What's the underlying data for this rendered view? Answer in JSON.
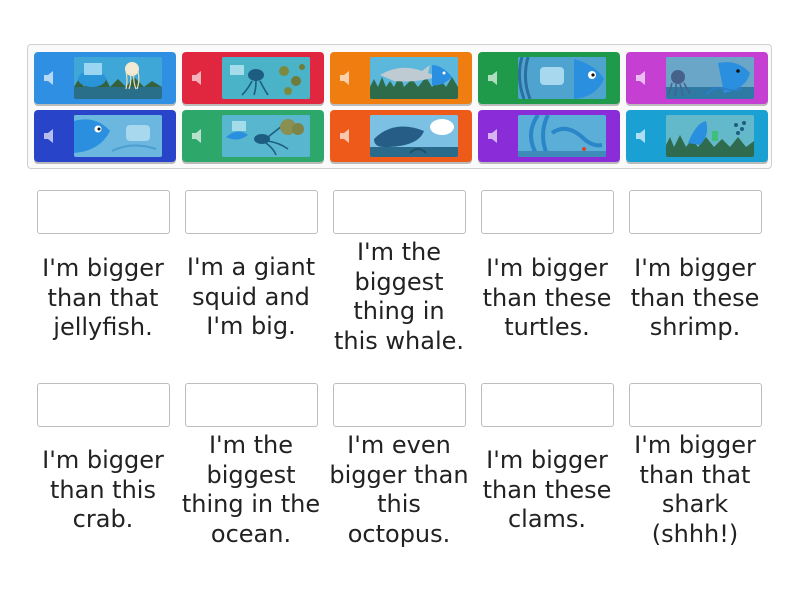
{
  "tiles": [
    {
      "color": "#2e8fe3",
      "picture": "jellyfish-picture"
    },
    {
      "color": "#e0273f",
      "picture": "turtles-picture"
    },
    {
      "color": "#f07d10",
      "picture": "shark-picture"
    },
    {
      "color": "#1f9a4a",
      "picture": "whale-picture"
    },
    {
      "color": "#c53fd2",
      "picture": "octopus-picture"
    },
    {
      "color": "#2845c9",
      "picture": "whale-tail-picture"
    },
    {
      "color": "#2ea86a",
      "picture": "squid-picture"
    },
    {
      "color": "#ee5a19",
      "picture": "whale-ocean-picture"
    },
    {
      "color": "#8a2dd9",
      "picture": "crab-picture"
    },
    {
      "color": "#1aa0d3",
      "picture": "shrimp-picture"
    }
  ],
  "labels": [
    "I'm bigger than that jellyfish.",
    "I'm a giant squid and I'm big.",
    "I'm the biggest thing in this whale.",
    "I'm bigger than these turtles.",
    "I'm bigger than these shrimp.",
    "I'm bigger than this crab.",
    "I'm the biggest thing in the ocean.",
    "I'm even bigger than this octopus.",
    "I'm bigger than these clams.",
    "I'm bigger than that shark (shhh!)"
  ]
}
